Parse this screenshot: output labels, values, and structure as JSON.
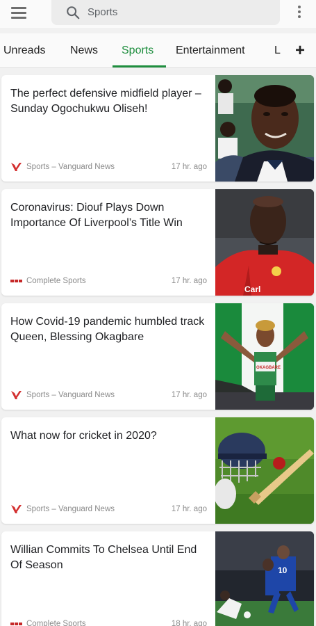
{
  "search": {
    "query": "Sports"
  },
  "tabs": [
    {
      "label": "Unreads"
    },
    {
      "label": "News"
    },
    {
      "label": "Sports"
    },
    {
      "label": "Entertainment"
    },
    {
      "label": "L"
    }
  ],
  "active_tab": "Sports",
  "add_tab_label": "+",
  "colors": {
    "accent": "#1e8e3e",
    "vanguard_logo": "#d32f2f",
    "complete_sports_logo": "#c62828"
  },
  "articles": [
    {
      "title": "The perfect defensive midfield player – Sunday Ogochukwu Oliseh!",
      "source": "Sports – Vanguard News",
      "source_icon": "vanguard-logo-icon",
      "time": "17 hr. ago"
    },
    {
      "title": "Coronavirus: Diouf Plays Down Importance Of Liverpool’s Title Win",
      "source": "Complete Sports",
      "source_icon": "complete-sports-logo-icon",
      "time": "17 hr. ago"
    },
    {
      "title": "How Covid-19 pandemic humbled track Queen, Blessing Okagbare",
      "source": "Sports – Vanguard News",
      "source_icon": "vanguard-logo-icon",
      "time": "17 hr. ago"
    },
    {
      "title": "What now for cricket in 2020?",
      "source": "Sports – Vanguard News",
      "source_icon": "vanguard-logo-icon",
      "time": "17 hr. ago"
    },
    {
      "title": "Willian Commits To Chelsea Until End Of Season",
      "source": "Complete Sports",
      "source_icon": "complete-sports-logo-icon",
      "time": "18 hr. ago"
    }
  ]
}
